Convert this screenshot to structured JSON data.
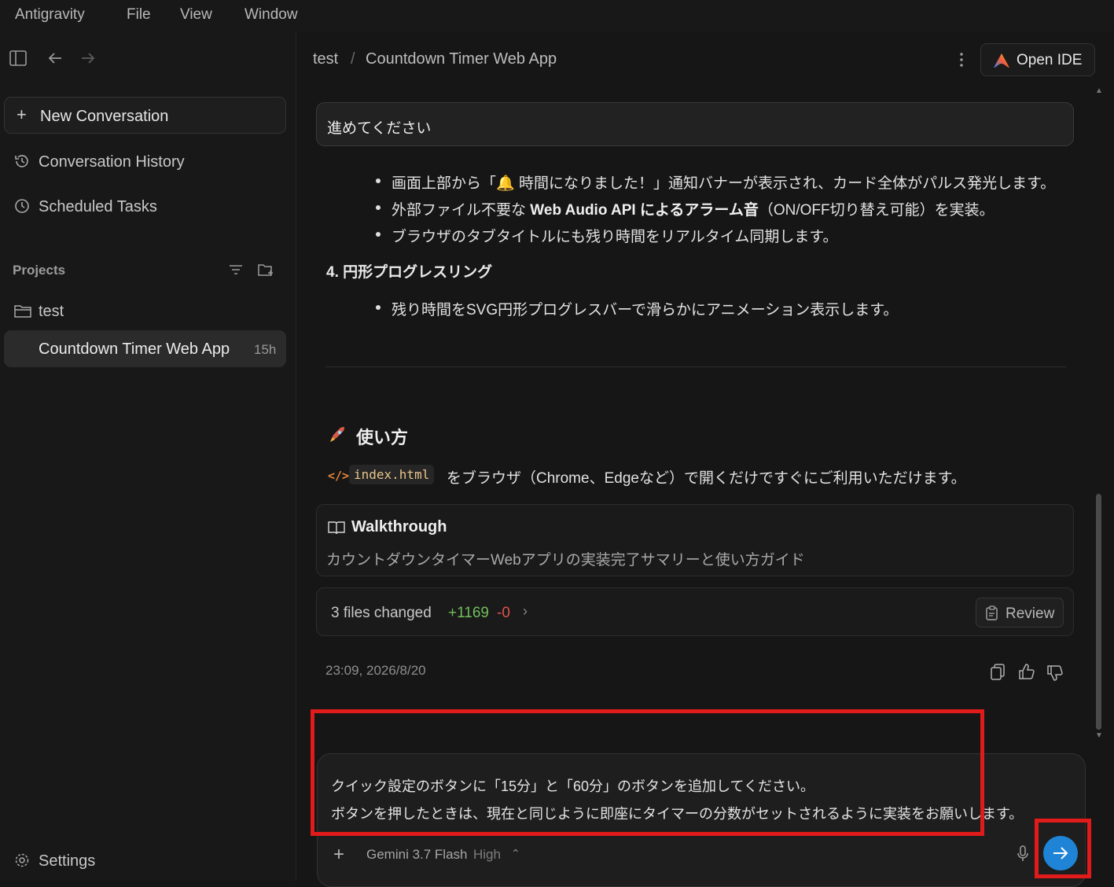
{
  "menubar": {
    "items": [
      "Antigravity",
      "File",
      "View",
      "Window"
    ]
  },
  "sidebar": {
    "new_conversation": "New Conversation",
    "conversation_history": "Conversation History",
    "scheduled_tasks": "Scheduled Tasks",
    "projects_label": "Projects",
    "project_name": "test",
    "conversation_title": "Countdown Timer Web App",
    "conversation_age": "15h",
    "settings": "Settings"
  },
  "header": {
    "breadcrumb_project": "test",
    "breadcrumb_sep": "/",
    "breadcrumb_title": "Countdown Timer Web App",
    "open_ide": "Open IDE"
  },
  "chat": {
    "user_message": "進めてください",
    "bullets_section3": [
      {
        "pre": "画面上部から「",
        "emoji": "🔔",
        "post": " 時間になりました！」通知バナーが表示され、カード全体がパルス発光します。"
      },
      {
        "pre": "外部ファイル不要な ",
        "bold": "Web Audio API によるアラーム音",
        "post": "（ON/OFF切り替え可能）を実装。"
      },
      {
        "text": "ブラウザのタブタイトルにも残り時間をリアルタイム同期します。"
      }
    ],
    "section4_heading": "4. 円形プログレスリング",
    "section4_bullet": "残り時間をSVG円形プログレスバーで滑らかにアニメーション表示します。",
    "usage_heading": "使い方",
    "usage_file": "index.html",
    "usage_text": "をブラウザ（Chrome、Edgeなど）で開くだけですぐにご利用いただけます。",
    "walkthrough_title": "Walkthrough",
    "walkthrough_desc": "カウントダウンタイマーWebアプリの実装完了サマリーと使い方ガイド",
    "files_changed": "3 files changed",
    "additions": "+1169",
    "deletions": "-0",
    "review": "Review",
    "timestamp": "23:09, 2026/8/20"
  },
  "composer": {
    "line1": "クイック設定のボタンに「15分」と「60分」のボタンを追加してください。",
    "line2": "ボタンを押したときは、現在と同じように即座にタイマーの分数がセットされるように実装をお願いします。",
    "model": "Gemini 3.7 Flash",
    "mode": "High"
  },
  "colors": {
    "accent": "#1f84d6",
    "add": "#6fbf5a",
    "del": "#e0534e",
    "highlight": "#e11a1a"
  }
}
